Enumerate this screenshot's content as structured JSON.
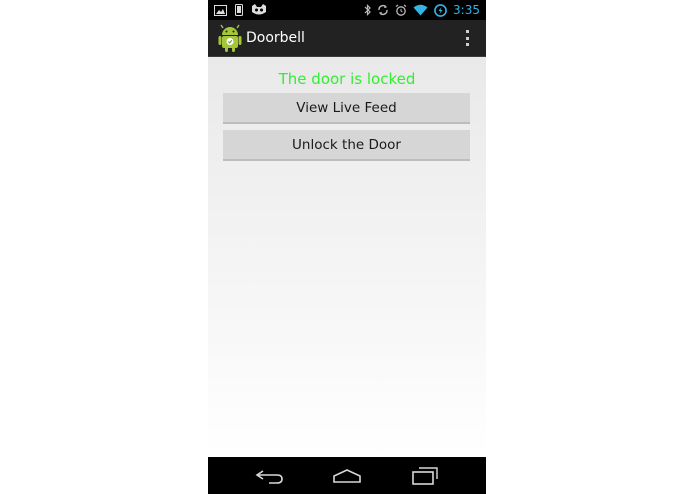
{
  "status_bar": {
    "time": "3:35",
    "icons": [
      "picture-icon",
      "phone-icon",
      "cat-icon",
      "bluetooth-icon",
      "sync-icon",
      "alarm-icon",
      "wifi-icon",
      "battery-icon"
    ]
  },
  "action_bar": {
    "title": "Doorbell",
    "app_icon": "android-icon",
    "overflow_icon": "overflow-menu-icon"
  },
  "main": {
    "status_text": "The door is locked",
    "status_color": "#33ee33",
    "buttons": {
      "view_feed": "View Live Feed",
      "unlock": "Unlock the Door"
    }
  },
  "nav_bar": {
    "icons": [
      "back-icon",
      "home-icon",
      "recent-apps-icon"
    ]
  },
  "colors": {
    "accent": "#33b5e5",
    "action_bar_bg": "#222222",
    "button_bg": "#d6d6d6"
  }
}
